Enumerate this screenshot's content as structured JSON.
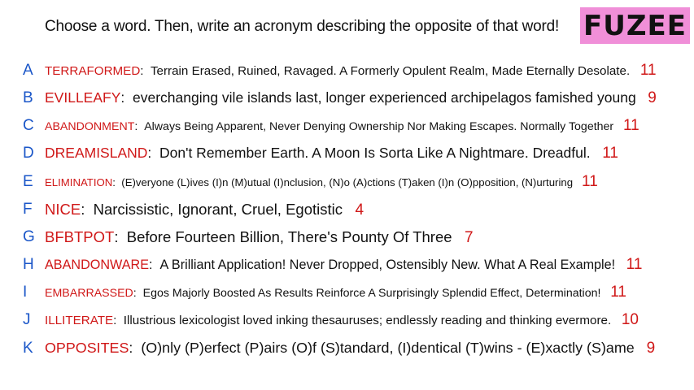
{
  "prompt": "Choose a word. Then, write an acronym describing the opposite of that word!",
  "logo": "FUZEE",
  "answers": [
    {
      "letter": "A",
      "word": "TERRAFORMED",
      "acronym": "Terrain Erased, Ruined, Ravaged. A Formerly Opulent Realm, Made Eternally Desolate.",
      "count": "11"
    },
    {
      "letter": "B",
      "word": "EVILLEAFY",
      "acronym": "everchanging vile islands last, longer experienced archipelagos famished young",
      "count": "9"
    },
    {
      "letter": "C",
      "word": "ABANDONMENT",
      "acronym": "Always Being Apparent, Never Denying Ownership Nor Making Escapes. Normally Together",
      "count": "11"
    },
    {
      "letter": "D",
      "word": "DREAMISLAND",
      "acronym": "Don't Remember Earth. A Moon Is Sorta Like A Nightmare. Dreadful.",
      "count": "11"
    },
    {
      "letter": "E",
      "word": "ELIMINATION",
      "acronym": "(E)veryone (L)ives (I)n (M)utual (I)nclusion, (N)o (A)ctions (T)aken (I)n (O)pposition, (N)urturing",
      "count": "11"
    },
    {
      "letter": "F",
      "word": "NICE",
      "acronym": "Narcissistic, Ignorant, Cruel, Egotistic",
      "count": "4"
    },
    {
      "letter": "G",
      "word": "BFBTPOT",
      "acronym": "Before Fourteen Billion, There's Pounty Of Three",
      "count": "7"
    },
    {
      "letter": "H",
      "word": "ABANDONWARE",
      "acronym": "A Brilliant Application! Never Dropped, Ostensibly New. What A Real Example!",
      "count": "11"
    },
    {
      "letter": "I",
      "word": "EMBARRASSED",
      "acronym": "Egos Majorly Boosted As Results Reinforce A Surprisingly Splendid Effect, Determination!",
      "count": "11"
    },
    {
      "letter": "J",
      "word": "ILLITERATE",
      "acronym": "Illustrious lexicologist loved inking thesauruses; endlessly reading and thinking evermore.",
      "count": "10"
    },
    {
      "letter": "K",
      "word": "OPPOSITES",
      "acronym": "(O)nly (P)erfect (P)airs (O)f (S)tandard, (I)dentical (T)wins - (E)xactly (S)ame",
      "count": "9"
    }
  ]
}
